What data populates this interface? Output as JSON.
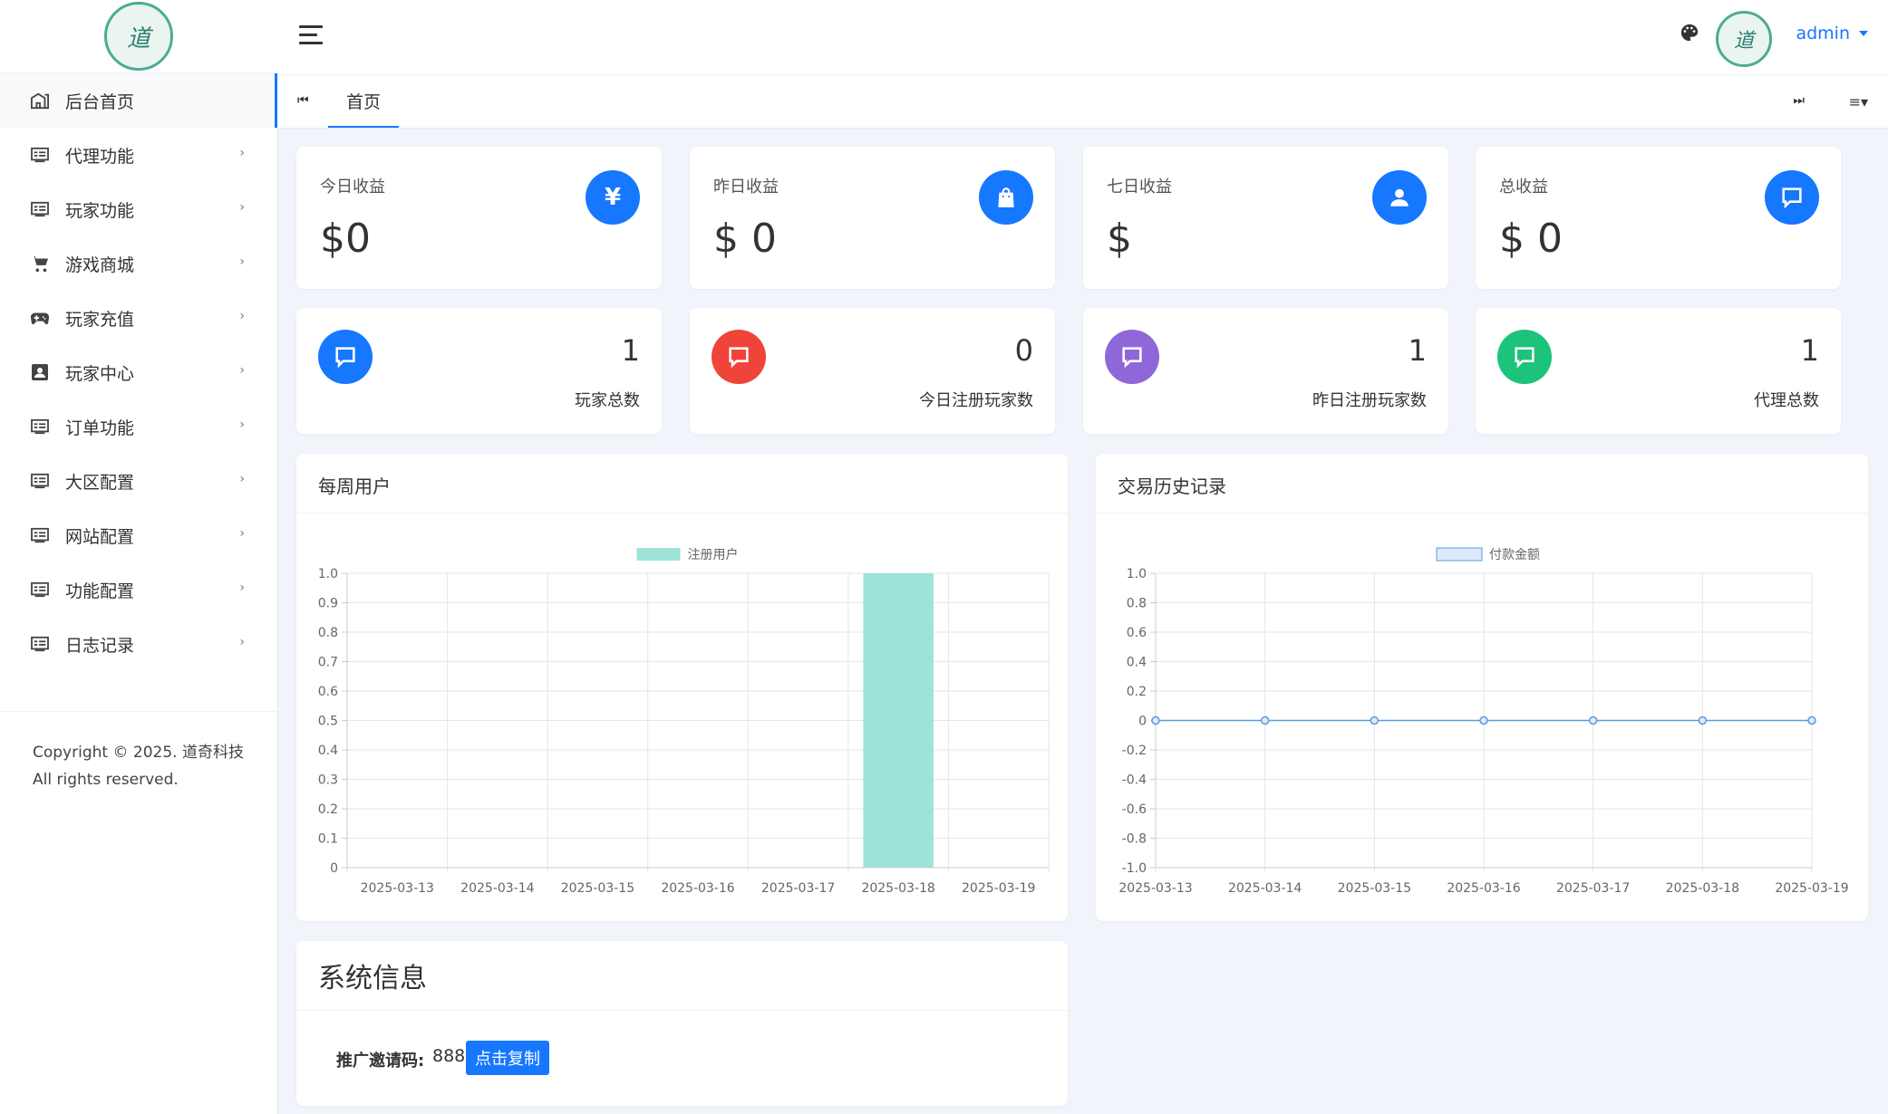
{
  "sidebar": {
    "items": [
      {
        "label": "后台首页",
        "icon": "home-icon",
        "active": true
      },
      {
        "label": "代理功能",
        "icon": "list-window-icon"
      },
      {
        "label": "玩家功能",
        "icon": "list-window-icon"
      },
      {
        "label": "游戏商城",
        "icon": "cart-icon"
      },
      {
        "label": "玩家充值",
        "icon": "gamepad-icon"
      },
      {
        "label": "玩家中心",
        "icon": "user-badge-icon"
      },
      {
        "label": "订单功能",
        "icon": "list-window-icon"
      },
      {
        "label": "大区配置",
        "icon": "list-window-icon"
      },
      {
        "label": "网站配置",
        "icon": "list-window-icon"
      },
      {
        "label": "功能配置",
        "icon": "list-window-icon"
      },
      {
        "label": "日志记录",
        "icon": "list-window-icon"
      }
    ],
    "chevron": "›",
    "copyright": "Copyright © 2025. 道奇科技 All rights reserved."
  },
  "header": {
    "user": "admin"
  },
  "tabs": {
    "home": "首页",
    "prev_icon": "⏮",
    "next_icon": "⏭",
    "menu_icon": "≡▾"
  },
  "stats": [
    {
      "label": "今日收益",
      "value": "$0",
      "icon": "yen-icon"
    },
    {
      "label": "昨日收益",
      "value": "$ 0",
      "icon": "bag-icon"
    },
    {
      "label": "七日收益",
      "value": "$",
      "icon": "user-icon"
    },
    {
      "label": "总收益",
      "value": "$ 0",
      "icon": "comment-icon"
    }
  ],
  "yen_symbol": "¥",
  "counts": [
    {
      "value": "1",
      "label": "玩家总数",
      "color": "#1677ff"
    },
    {
      "value": "0",
      "label": "今日注册玩家数",
      "color": "#f0443a"
    },
    {
      "value": "1",
      "label": "昨日注册玩家数",
      "color": "#9067d8"
    },
    {
      "value": "1",
      "label": "代理总数",
      "color": "#1cc37a"
    }
  ],
  "weekly_panel": {
    "title": "每周用户"
  },
  "trade_panel": {
    "title": "交易历史记录"
  },
  "chart_data": [
    {
      "type": "bar",
      "title": "每周用户",
      "categories": [
        "2025-03-13",
        "2025-03-14",
        "2025-03-15",
        "2025-03-16",
        "2025-03-17",
        "2025-03-18",
        "2025-03-19"
      ],
      "series": [
        {
          "name": "注册用户",
          "values": [
            0,
            0,
            0,
            0,
            0,
            1,
            0
          ],
          "color": "#9de3d9"
        }
      ],
      "ylim": [
        0,
        1.0
      ],
      "yticks": [
        "1.0",
        "0.9",
        "0.8",
        "0.7",
        "0.6",
        "0.5",
        "0.4",
        "0.3",
        "0.2",
        "0.1",
        "0"
      ],
      "grid": true,
      "legend": "top"
    },
    {
      "type": "line",
      "title": "交易历史记录",
      "categories": [
        "2025-03-13",
        "2025-03-14",
        "2025-03-15",
        "2025-03-16",
        "2025-03-17",
        "2025-03-18",
        "2025-03-19"
      ],
      "series": [
        {
          "name": "付款金额",
          "values": [
            0,
            0,
            0,
            0,
            0,
            0,
            0
          ],
          "color": "#5a9be0"
        }
      ],
      "ylim": [
        -1.0,
        1.0
      ],
      "yticks": [
        "1.0",
        "0.8",
        "0.6",
        "0.4",
        "0.2",
        "0",
        "-0.2",
        "-0.4",
        "-0.6",
        "-0.8",
        "-1.0"
      ],
      "grid": true,
      "legend": "top"
    }
  ],
  "system_info": {
    "title": "系统信息",
    "invite_label": "推广邀请码:",
    "invite_code": "888",
    "copy_button": "点击复制"
  }
}
